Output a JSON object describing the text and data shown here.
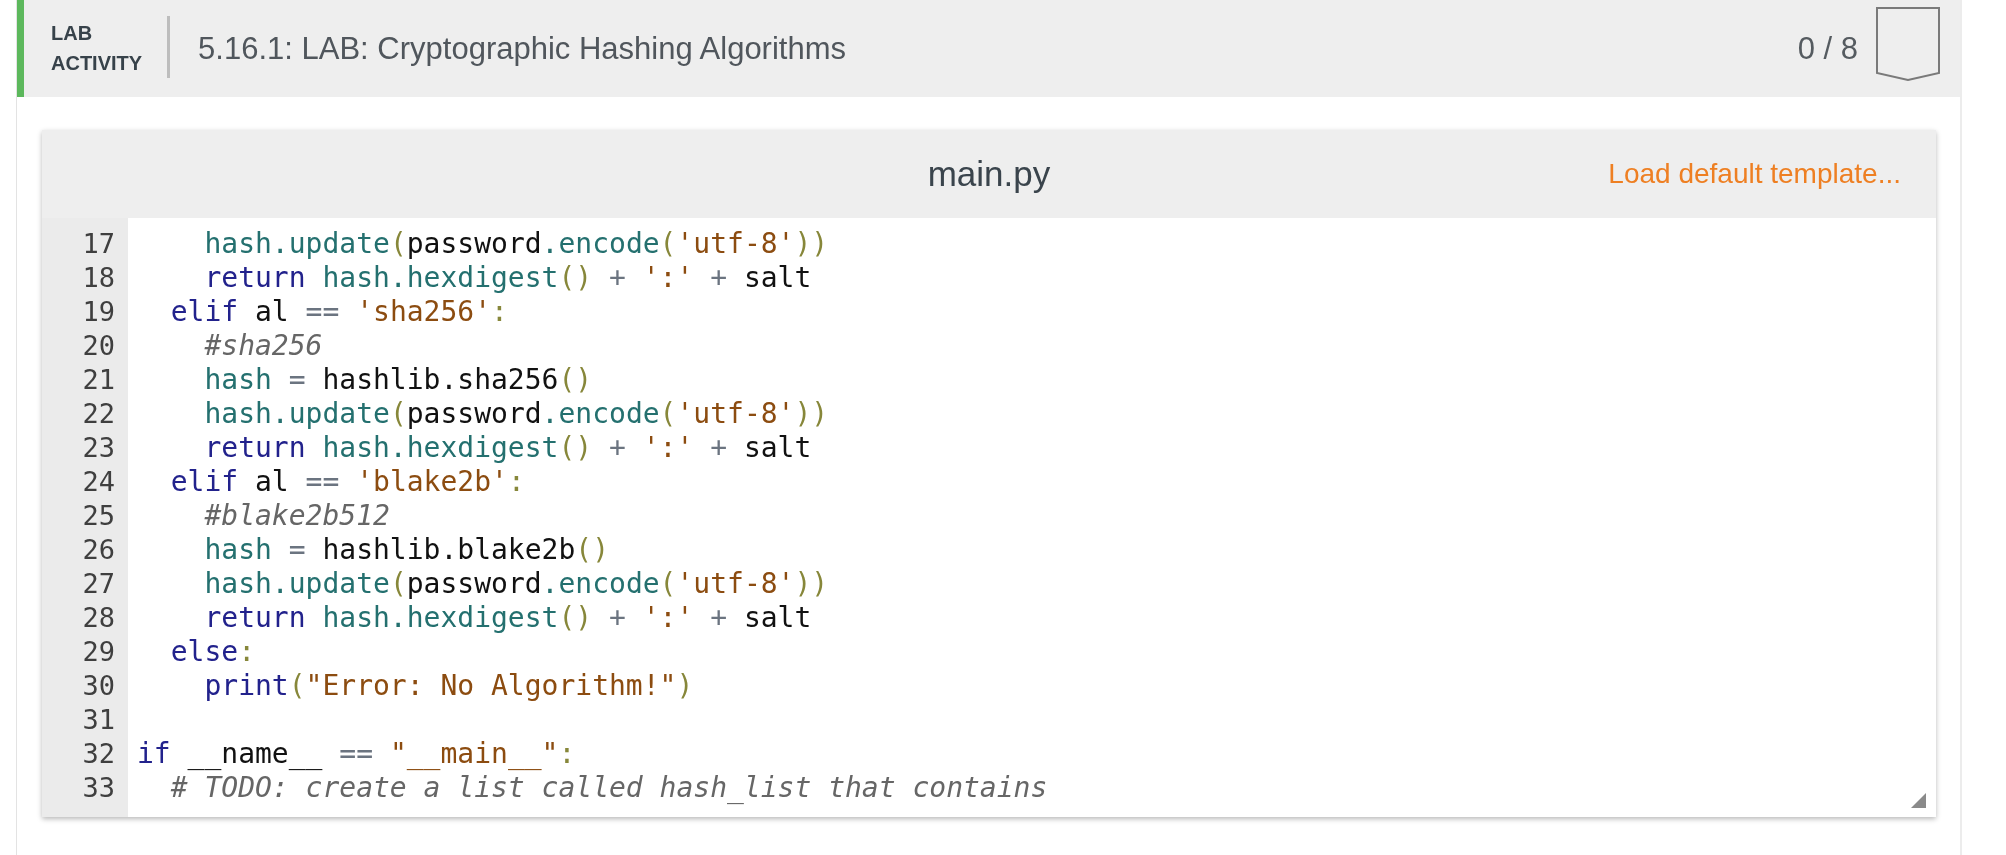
{
  "header": {
    "label": "LAB ACTIVITY",
    "title": "5.16.1: LAB: Cryptographic Hashing Algorithms",
    "score": "0 / 8"
  },
  "editor": {
    "file_name": "main.py",
    "load_template": "Load default template...",
    "lines": [
      {
        "number": "17",
        "tokens": [
          {
            "kind": "name",
            "text": "    hash.update"
          },
          {
            "kind": "punct",
            "text": "("
          },
          {
            "kind": "plain",
            "text": "password"
          },
          {
            "kind": "name",
            "text": ".encode"
          },
          {
            "kind": "punct",
            "text": "("
          },
          {
            "kind": "string",
            "text": "'utf-8'"
          },
          {
            "kind": "punct",
            "text": "))"
          }
        ]
      },
      {
        "number": "18",
        "tokens": [
          {
            "kind": "keyword",
            "text": "    return"
          },
          {
            "kind": "name",
            "text": " hash.hexdigest"
          },
          {
            "kind": "punct",
            "text": "()"
          },
          {
            "kind": "operator",
            "text": " + "
          },
          {
            "kind": "string",
            "text": "':'"
          },
          {
            "kind": "operator",
            "text": " + "
          },
          {
            "kind": "plain",
            "text": "salt"
          }
        ]
      },
      {
        "number": "19",
        "tokens": [
          {
            "kind": "keyword",
            "text": "  elif"
          },
          {
            "kind": "plain",
            "text": " al "
          },
          {
            "kind": "operator",
            "text": "== "
          },
          {
            "kind": "string",
            "text": "'sha256'"
          },
          {
            "kind": "punct",
            "text": ":"
          }
        ]
      },
      {
        "number": "20",
        "tokens": [
          {
            "kind": "comment",
            "text": "    #sha256"
          }
        ]
      },
      {
        "number": "21",
        "tokens": [
          {
            "kind": "name",
            "text": "    hash"
          },
          {
            "kind": "operator",
            "text": " = "
          },
          {
            "kind": "plain",
            "text": "hashlib.sha256"
          },
          {
            "kind": "punct",
            "text": "()"
          }
        ]
      },
      {
        "number": "22",
        "tokens": [
          {
            "kind": "name",
            "text": "    hash.update"
          },
          {
            "kind": "punct",
            "text": "("
          },
          {
            "kind": "plain",
            "text": "password"
          },
          {
            "kind": "name",
            "text": ".encode"
          },
          {
            "kind": "punct",
            "text": "("
          },
          {
            "kind": "string",
            "text": "'utf-8'"
          },
          {
            "kind": "punct",
            "text": "))"
          }
        ]
      },
      {
        "number": "23",
        "tokens": [
          {
            "kind": "keyword",
            "text": "    return"
          },
          {
            "kind": "name",
            "text": " hash.hexdigest"
          },
          {
            "kind": "punct",
            "text": "()"
          },
          {
            "kind": "operator",
            "text": " + "
          },
          {
            "kind": "string",
            "text": "':'"
          },
          {
            "kind": "operator",
            "text": " + "
          },
          {
            "kind": "plain",
            "text": "salt"
          }
        ]
      },
      {
        "number": "24",
        "tokens": [
          {
            "kind": "keyword",
            "text": "  elif"
          },
          {
            "kind": "plain",
            "text": " al "
          },
          {
            "kind": "operator",
            "text": "== "
          },
          {
            "kind": "string",
            "text": "'blake2b'"
          },
          {
            "kind": "punct",
            "text": ":"
          }
        ]
      },
      {
        "number": "25",
        "tokens": [
          {
            "kind": "comment",
            "text": "    #blake2b512"
          }
        ]
      },
      {
        "number": "26",
        "tokens": [
          {
            "kind": "name",
            "text": "    hash"
          },
          {
            "kind": "operator",
            "text": " = "
          },
          {
            "kind": "plain",
            "text": "hashlib.blake2b"
          },
          {
            "kind": "punct",
            "text": "()"
          }
        ]
      },
      {
        "number": "27",
        "tokens": [
          {
            "kind": "name",
            "text": "    hash.update"
          },
          {
            "kind": "punct",
            "text": "("
          },
          {
            "kind": "plain",
            "text": "password"
          },
          {
            "kind": "name",
            "text": ".encode"
          },
          {
            "kind": "punct",
            "text": "("
          },
          {
            "kind": "string",
            "text": "'utf-8'"
          },
          {
            "kind": "punct",
            "text": "))"
          }
        ]
      },
      {
        "number": "28",
        "tokens": [
          {
            "kind": "keyword",
            "text": "    return"
          },
          {
            "kind": "name",
            "text": " hash.hexdigest"
          },
          {
            "kind": "punct",
            "text": "()"
          },
          {
            "kind": "operator",
            "text": " + "
          },
          {
            "kind": "string",
            "text": "':'"
          },
          {
            "kind": "operator",
            "text": " + "
          },
          {
            "kind": "plain",
            "text": "salt"
          }
        ]
      },
      {
        "number": "29",
        "tokens": [
          {
            "kind": "keyword",
            "text": "  else"
          },
          {
            "kind": "punct",
            "text": ":"
          }
        ]
      },
      {
        "number": "30",
        "tokens": [
          {
            "kind": "keyword",
            "text": "    print"
          },
          {
            "kind": "punct",
            "text": "("
          },
          {
            "kind": "string",
            "text": "\"Error: No Algorithm!\""
          },
          {
            "kind": "punct",
            "text": ")"
          }
        ]
      },
      {
        "number": "31"
      },
      {
        "number": "32",
        "tokens": [
          {
            "kind": "keyword",
            "text": "if"
          },
          {
            "kind": "plain",
            "text": " __name__ "
          },
          {
            "kind": "operator",
            "text": "== "
          },
          {
            "kind": "string",
            "text": "\"__main__\""
          },
          {
            "kind": "punct",
            "text": ":"
          }
        ]
      },
      {
        "number": "33",
        "tokens": [
          {
            "kind": "comment",
            "text": "  # TODO: create a list called hash_list that contains"
          }
        ]
      }
    ]
  }
}
